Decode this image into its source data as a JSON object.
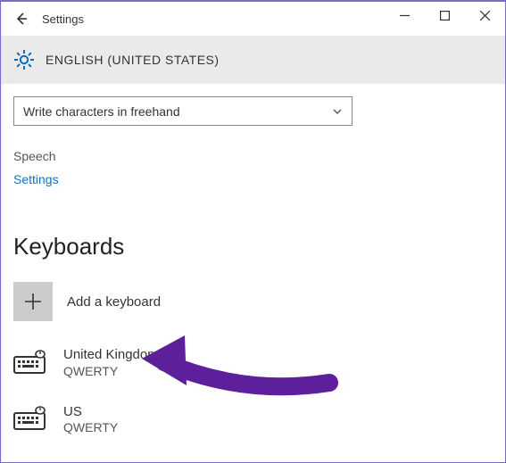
{
  "titlebar": {
    "title": "Settings"
  },
  "header": {
    "title": "ENGLISH (UNITED STATES)"
  },
  "dropdown": {
    "selected": "Write characters in freehand"
  },
  "speech": {
    "label": "Speech",
    "settings_link": "Settings"
  },
  "keyboards": {
    "heading": "Keyboards",
    "add_label": "Add a keyboard",
    "items": [
      {
        "name": "United Kingdom",
        "layout": "QWERTY"
      },
      {
        "name": "US",
        "layout": "QWERTY"
      }
    ]
  },
  "annotation": {
    "color": "#5d1f9c"
  }
}
